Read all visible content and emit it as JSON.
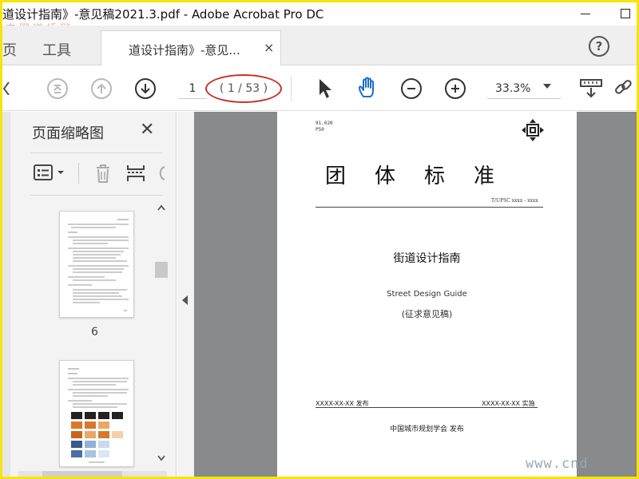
{
  "window": {
    "title": "道设计指南》-意见稿2021.3.pdf - Adobe Acrobat Pro DC"
  },
  "tabs": {
    "page_nav": "页",
    "tools": "工具",
    "document": "道设计指南》-意见...",
    "close_glyph": "×",
    "help_glyph": "?"
  },
  "toolbar": {
    "current_page": "1",
    "page_count": "( 1 / 53 )",
    "zoom": "33.3%"
  },
  "thumbnails": {
    "title": "页面缩略图",
    "close_glyph": "✕",
    "pages": [
      {
        "label": "6"
      }
    ]
  },
  "page": {
    "ics": "91.020",
    "ccs": "P50",
    "heading": "团体标准",
    "standard_no": "T/UPSC  xxxx - xxxx",
    "title_cn": "街道设计指南",
    "title_en": "Street Design Guide",
    "draft": "(征求意见稿)",
    "issue_date": "XXXX-XX-XX 发布",
    "impl_date": "XXXX-XX-XX 实施",
    "publisher": "中国城市规划学会  发布"
  },
  "watermark": {
    "top_left": "中国道桥网",
    "bottom_right": "www.cnd"
  },
  "colors": {
    "frame": "#f5e50a",
    "annotation": "#c8312a",
    "doc_bg": "#888a8c"
  }
}
